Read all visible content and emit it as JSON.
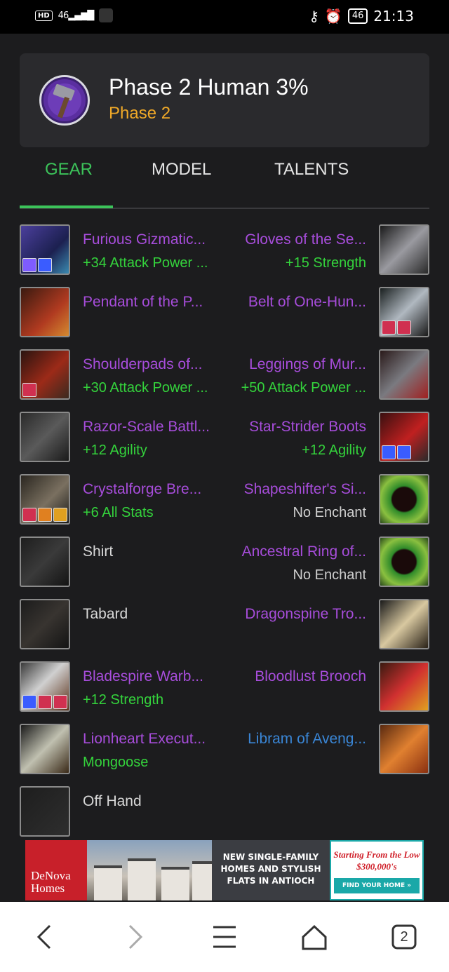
{
  "statusbar": {
    "hd": "HD",
    "signal": "46",
    "battery": "46",
    "time": "21:13",
    "icons": [
      "key-icon",
      "alarm-icon"
    ]
  },
  "header": {
    "title": "Phase 2 Human 3%",
    "subtitle": "Phase 2",
    "subtitle_color": "#f0a928",
    "avatar_icon": "hammer-icon"
  },
  "tabs": [
    {
      "label": "GEAR",
      "active": true
    },
    {
      "label": "MODEL",
      "active": false
    },
    {
      "label": "TALENTS",
      "active": false
    }
  ],
  "gear": [
    {
      "left": {
        "name": "Furious Gizmatic...",
        "enchant": "+34 Attack Power ..."
      },
      "right": {
        "name": "Gloves of the Se...",
        "enchant": "+15 Strength"
      }
    },
    {
      "left": {
        "name": "Pendant of the P...",
        "enchant": ""
      },
      "right": {
        "name": "Belt of One-Hun...",
        "enchant": ""
      }
    },
    {
      "left": {
        "name": "Shoulderpads of...",
        "enchant": "+30 Attack Power ..."
      },
      "right": {
        "name": "Leggings of Mur...",
        "enchant": "+50 Attack Power ..."
      }
    },
    {
      "left": {
        "name": "Razor-Scale Battl...",
        "enchant": "+12 Agility"
      },
      "right": {
        "name": "Star-Strider Boots",
        "enchant": "+12 Agility"
      }
    },
    {
      "left": {
        "name": "Crystalforge Bre...",
        "enchant": "+6 All Stats"
      },
      "right": {
        "name": "Shapeshifter's Si...",
        "enchant": "No Enchant"
      }
    },
    {
      "left": {
        "name": "Shirt",
        "enchant": ""
      },
      "right": {
        "name": "Ancestral Ring of...",
        "enchant": "No Enchant"
      }
    },
    {
      "left": {
        "name": "Tabard",
        "enchant": ""
      },
      "right": {
        "name": "Dragonspine Tro...",
        "enchant": ""
      }
    },
    {
      "left": {
        "name": "Bladespire Warb...",
        "enchant": "+12 Strength"
      },
      "right": {
        "name": "Bloodlust Brooch",
        "enchant": ""
      }
    },
    {
      "left": {
        "name": "Lionheart Execut...",
        "enchant": "Mongoose"
      },
      "right": {
        "name": "Libram of Aveng...",
        "enchant": ""
      }
    },
    {
      "left": {
        "name": "Off Hand",
        "enchant": ""
      }
    }
  ],
  "colors": {
    "epic": "#a74ddb",
    "rare": "#3a86d6",
    "common": "#d8d8d8",
    "enchant": "#34d33c",
    "accent": "#3cc35a"
  },
  "ad": {
    "brand": "DeNova Homes",
    "copy": "NEW SINGLE-FAMILY HOMES AND STYLISH FLATS IN ANTIOCH",
    "price": "Starting From the Low $300,000's",
    "cta": "FIND YOUR HOME »"
  },
  "navbar": {
    "tab_count": "2",
    "icons": [
      "back-icon",
      "forward-icon",
      "menu-icon",
      "home-icon",
      "tabs-icon"
    ]
  }
}
